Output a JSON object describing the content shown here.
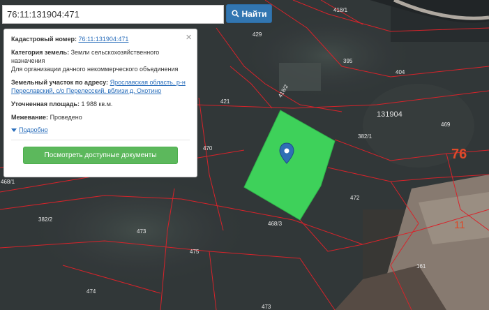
{
  "search": {
    "value": "76:11:131904:471",
    "button_label": "Найти"
  },
  "info": {
    "cadastral_label": "Кадастровый номер:",
    "cadastral_value": "76:11:131904:471",
    "category_label": "Категория земель:",
    "category_value": "Земли сельскохозяйственного назначения",
    "category_use": "Для организации дачного некоммерческого объединения",
    "address_label": "Земельный участок по адресу:",
    "address_value": "Ярославская область, р-н Переславский, с/о Перелесский, вблизи д. Охотино",
    "area_label": "Уточненная площадь:",
    "area_value": "1 988 кв.м.",
    "survey_label": "Межевание:",
    "survey_value": "Проведено",
    "more_label": "Подробно",
    "docs_button": "Посмотреть доступные документы",
    "close_symbol": "×"
  },
  "map": {
    "labels": [
      "418/1",
      "429",
      "395",
      "404",
      "418/2",
      "421",
      "131904",
      "382/1",
      "469",
      "76",
      "470",
      "468/1",
      "472",
      "382/2",
      "473",
      "468/3",
      "11",
      "475",
      "161",
      "474",
      "473"
    ],
    "highlight_color": "#3ed15a",
    "marker_color": "#2f6fb5",
    "boundary_color": "#d8232a"
  }
}
